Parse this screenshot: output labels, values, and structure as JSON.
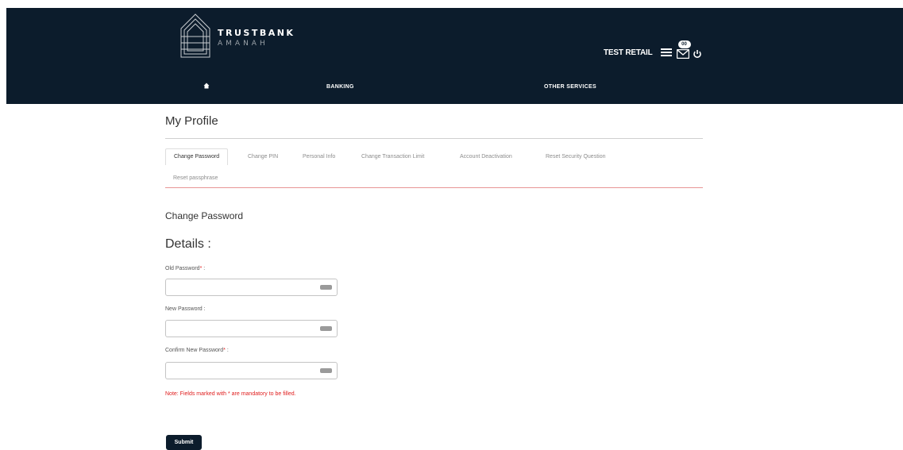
{
  "colors": {
    "navy": "#0c1c2c",
    "accent_red": "#e02020",
    "tab_underline": "#e79595"
  },
  "brand": {
    "name": "TRUSTBANK",
    "sub": "AMANAH",
    "logo_icon": "pyramid-logo-icon"
  },
  "header": {
    "user_name": "TEST RETAIL",
    "menu_icon": "hamburger-menu-icon",
    "mail_icon": "mail-icon",
    "mail_badge": "00",
    "power_icon": "power-icon"
  },
  "nav": {
    "home_icon": "home-icon",
    "items": [
      {
        "label": "BANKING"
      },
      {
        "label": "OTHER SERVICES"
      }
    ]
  },
  "page": {
    "title": "My Profile"
  },
  "tabs": [
    {
      "label": "Change Password",
      "active": true
    },
    {
      "label": "Change PIN"
    },
    {
      "label": "Personal Info"
    },
    {
      "label": "Change Transaction Limit"
    },
    {
      "label": "Account Deactivation"
    },
    {
      "label": "Reset Security Question"
    },
    {
      "label": "Reset passphrase"
    }
  ],
  "form": {
    "section_title": "Change Password",
    "details_title": "Details :",
    "fields": [
      {
        "label": "Old Password",
        "required": "*",
        "suffix": " :",
        "value": ""
      },
      {
        "label": "New Password",
        "required": "",
        "suffix": " :",
        "value": ""
      },
      {
        "label": "Confirm New Password",
        "required": "*",
        "suffix": " :",
        "value": ""
      }
    ],
    "key_icon": "virtual-keyboard-icon",
    "note": "Note: Fields marked with * are mandatory to be filled.",
    "submit_label": "Submit"
  }
}
